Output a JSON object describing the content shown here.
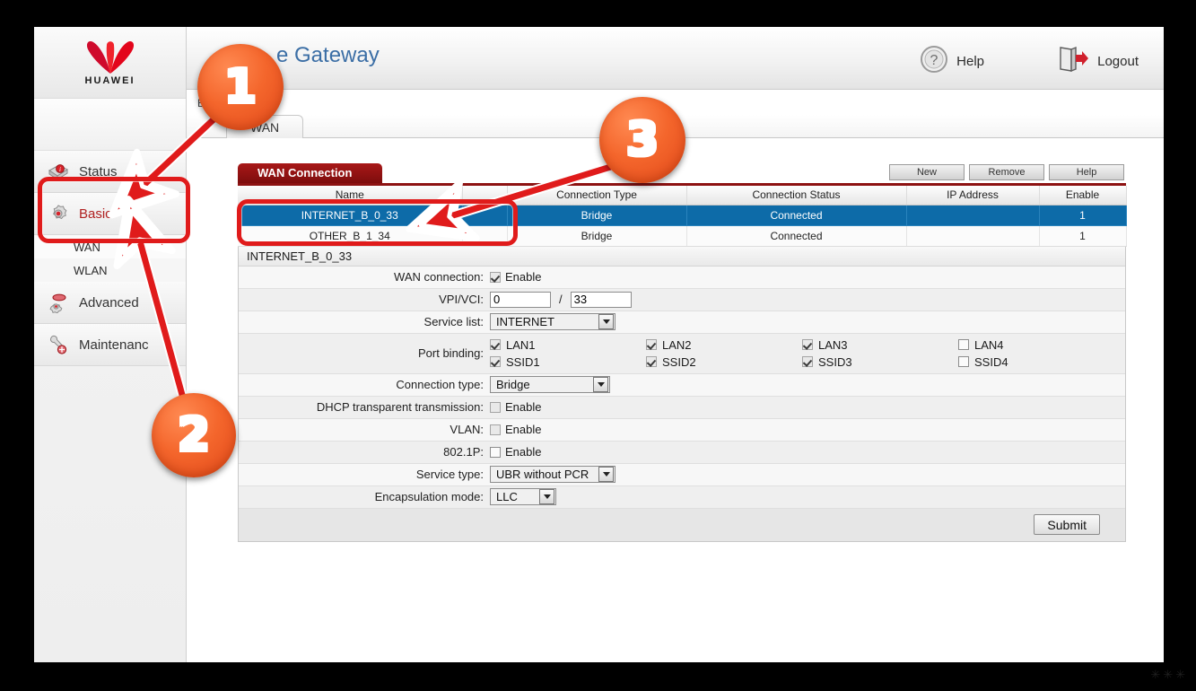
{
  "app": {
    "title": "e Gateway",
    "brand": "HUAWEI",
    "breadcrumb": "Ba",
    "help_label": "Help",
    "logout_label": "Logout",
    "accent_red": "#a81818",
    "accent_blue": "#0d6ba8",
    "title_color": "#3b6ea5",
    "badge_color": "#f4662c",
    "highlight_color": "#e01b1b",
    "corner_marks": "✳✳✳"
  },
  "sidebar": {
    "items": [
      {
        "label": "Status",
        "icon": "info-disk-icon",
        "active": false
      },
      {
        "label": "Basic",
        "icon": "gear-icon",
        "active": true
      },
      {
        "label": "Advanced",
        "icon": "gears-icon",
        "active": false
      },
      {
        "label": "Maintenanc",
        "icon": "wrench-icon",
        "active": false
      }
    ],
    "sub_items": [
      {
        "label": "WAN"
      },
      {
        "label": "WLAN"
      }
    ]
  },
  "tabs": [
    {
      "label": "WAN",
      "selected": true
    }
  ],
  "panel": {
    "tab_label": "WAN Connection",
    "buttons": [
      {
        "label": "New"
      },
      {
        "label": "Remove"
      },
      {
        "label": "Help"
      }
    ]
  },
  "table": {
    "columns": [
      "Name",
      "Connection Type",
      "Connection Status",
      "IP Address",
      "Enable"
    ],
    "rows": [
      {
        "name": "INTERNET_B_0_33",
        "connection_type": "Bridge",
        "connection_status": "Connected",
        "ip_address": "",
        "enable": "1",
        "selected": true
      },
      {
        "name": "OTHER_B_1_34",
        "connection_type": "Bridge",
        "connection_status": "Connected",
        "ip_address": "",
        "enable": "1",
        "selected": false
      }
    ]
  },
  "form": {
    "heading": "INTERNET_B_0_33",
    "wan_connection": {
      "label": "WAN connection:",
      "enable_label": "Enable",
      "checked": true
    },
    "vpi_vci": {
      "label": "VPI/VCI:",
      "vpi": "0",
      "vci": "33",
      "separator": "/"
    },
    "service_list": {
      "label": "Service list:",
      "value": "INTERNET"
    },
    "port_binding": {
      "label": "Port binding:",
      "columns": [
        {
          "lan": {
            "label": "LAN1",
            "checked": true
          },
          "ssid": {
            "label": "SSID1",
            "checked": true
          }
        },
        {
          "lan": {
            "label": "LAN2",
            "checked": true
          },
          "ssid": {
            "label": "SSID2",
            "checked": true
          }
        },
        {
          "lan": {
            "label": "LAN3",
            "checked": true
          },
          "ssid": {
            "label": "SSID3",
            "checked": true
          }
        },
        {
          "lan": {
            "label": "LAN4",
            "checked": false
          },
          "ssid": {
            "label": "SSID4",
            "checked": false
          }
        }
      ]
    },
    "connection_type": {
      "label": "Connection type:",
      "value": "Bridge"
    },
    "dhcp_transparent": {
      "label": "DHCP transparent transmission:",
      "enable_label": "Enable",
      "checked": false
    },
    "vlan": {
      "label": "VLAN:",
      "enable_label": "Enable",
      "checked": false
    },
    "dot1p": {
      "label": "802.1P:",
      "enable_label": "Enable",
      "checked": false
    },
    "service_type": {
      "label": "Service type:",
      "value": "UBR without PCR"
    },
    "encapsulation_mode": {
      "label": "Encapsulation mode:",
      "value": "LLC"
    },
    "submit_label": "Submit"
  },
  "annotations": {
    "badges": [
      {
        "number": "1"
      },
      {
        "number": "2"
      },
      {
        "number": "3"
      }
    ]
  }
}
